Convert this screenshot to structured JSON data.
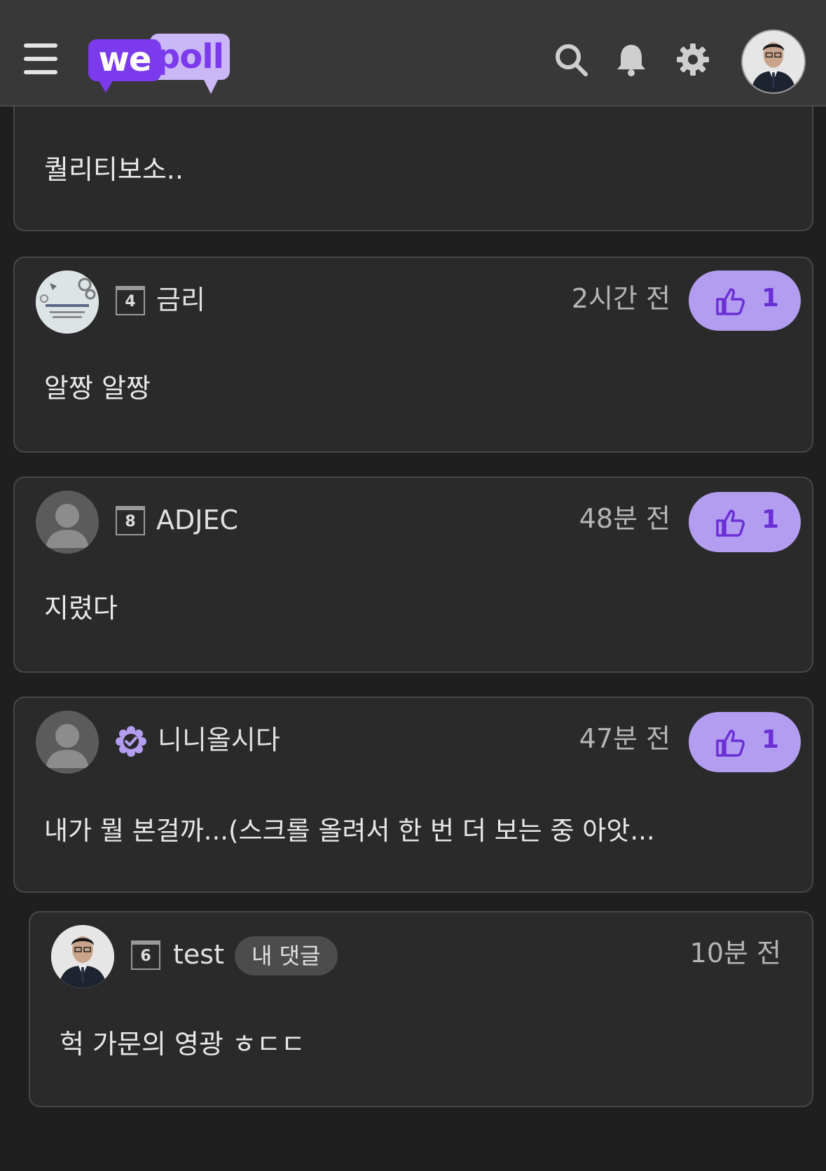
{
  "header": {
    "logo_we": "we",
    "logo_poll": "poll",
    "icons": [
      "menu-icon",
      "search-icon",
      "bell-icon",
      "gear-icon"
    ]
  },
  "colors": {
    "accent": "#7c3aed",
    "like_button_bg": "#b39df0",
    "card_bg": "#2a2a2b",
    "page_bg": "#1f1f1f"
  },
  "comments": [
    {
      "text": "퀄리티보소.."
    },
    {
      "level": "4",
      "username": "금리",
      "time": "2시간 전",
      "likes": "1",
      "text": "알짱 알짱"
    },
    {
      "level": "8",
      "username": "ADJEC",
      "time": "48분 전",
      "likes": "1",
      "text": "지렸다"
    },
    {
      "verified": true,
      "username": "니니올시다",
      "time": "47분 전",
      "likes": "1",
      "text": "내가 뭘 본걸까...(스크롤 올려서 한 번 더 보는 중 아앗..."
    }
  ],
  "reply": {
    "level": "6",
    "username": "test",
    "badge": "내 댓글",
    "time": "10분 전",
    "text": "헉 가문의 영광 ㅎㄷㄷ"
  }
}
